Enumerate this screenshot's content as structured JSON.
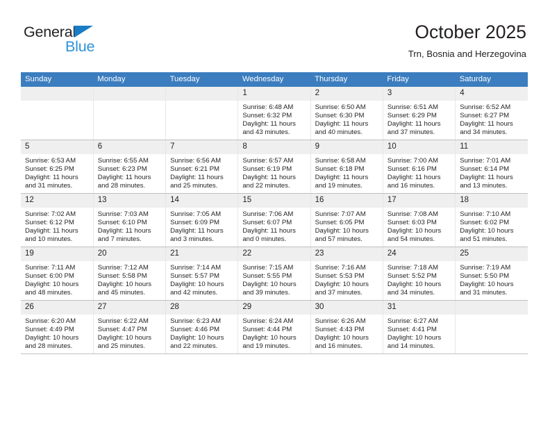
{
  "brand": {
    "name_top": "General",
    "name_bottom": "Blue",
    "accent_color": "#1a7cc4",
    "blue_text_color": "#2f92d8"
  },
  "header": {
    "title": "October 2025",
    "subtitle": "Trn, Bosnia and Herzegovina"
  },
  "calendar": {
    "header_bg": "#3b7dbf",
    "daynum_bg": "#efefef",
    "weekdays": [
      "Sunday",
      "Monday",
      "Tuesday",
      "Wednesday",
      "Thursday",
      "Friday",
      "Saturday"
    ],
    "weeks": [
      [
        {
          "day": "",
          "empty": true,
          "sunrise": "",
          "sunset": "",
          "daylight_1": "",
          "daylight_2": ""
        },
        {
          "day": "",
          "empty": true,
          "sunrise": "",
          "sunset": "",
          "daylight_1": "",
          "daylight_2": ""
        },
        {
          "day": "",
          "empty": true,
          "sunrise": "",
          "sunset": "",
          "daylight_1": "",
          "daylight_2": ""
        },
        {
          "day": "1",
          "empty": false,
          "sunrise": "Sunrise: 6:48 AM",
          "sunset": "Sunset: 6:32 PM",
          "daylight_1": "Daylight: 11 hours",
          "daylight_2": "and 43 minutes."
        },
        {
          "day": "2",
          "empty": false,
          "sunrise": "Sunrise: 6:50 AM",
          "sunset": "Sunset: 6:30 PM",
          "daylight_1": "Daylight: 11 hours",
          "daylight_2": "and 40 minutes."
        },
        {
          "day": "3",
          "empty": false,
          "sunrise": "Sunrise: 6:51 AM",
          "sunset": "Sunset: 6:29 PM",
          "daylight_1": "Daylight: 11 hours",
          "daylight_2": "and 37 minutes."
        },
        {
          "day": "4",
          "empty": false,
          "sunrise": "Sunrise: 6:52 AM",
          "sunset": "Sunset: 6:27 PM",
          "daylight_1": "Daylight: 11 hours",
          "daylight_2": "and 34 minutes."
        }
      ],
      [
        {
          "day": "5",
          "empty": false,
          "sunrise": "Sunrise: 6:53 AM",
          "sunset": "Sunset: 6:25 PM",
          "daylight_1": "Daylight: 11 hours",
          "daylight_2": "and 31 minutes."
        },
        {
          "day": "6",
          "empty": false,
          "sunrise": "Sunrise: 6:55 AM",
          "sunset": "Sunset: 6:23 PM",
          "daylight_1": "Daylight: 11 hours",
          "daylight_2": "and 28 minutes."
        },
        {
          "day": "7",
          "empty": false,
          "sunrise": "Sunrise: 6:56 AM",
          "sunset": "Sunset: 6:21 PM",
          "daylight_1": "Daylight: 11 hours",
          "daylight_2": "and 25 minutes."
        },
        {
          "day": "8",
          "empty": false,
          "sunrise": "Sunrise: 6:57 AM",
          "sunset": "Sunset: 6:19 PM",
          "daylight_1": "Daylight: 11 hours",
          "daylight_2": "and 22 minutes."
        },
        {
          "day": "9",
          "empty": false,
          "sunrise": "Sunrise: 6:58 AM",
          "sunset": "Sunset: 6:18 PM",
          "daylight_1": "Daylight: 11 hours",
          "daylight_2": "and 19 minutes."
        },
        {
          "day": "10",
          "empty": false,
          "sunrise": "Sunrise: 7:00 AM",
          "sunset": "Sunset: 6:16 PM",
          "daylight_1": "Daylight: 11 hours",
          "daylight_2": "and 16 minutes."
        },
        {
          "day": "11",
          "empty": false,
          "sunrise": "Sunrise: 7:01 AM",
          "sunset": "Sunset: 6:14 PM",
          "daylight_1": "Daylight: 11 hours",
          "daylight_2": "and 13 minutes."
        }
      ],
      [
        {
          "day": "12",
          "empty": false,
          "sunrise": "Sunrise: 7:02 AM",
          "sunset": "Sunset: 6:12 PM",
          "daylight_1": "Daylight: 11 hours",
          "daylight_2": "and 10 minutes."
        },
        {
          "day": "13",
          "empty": false,
          "sunrise": "Sunrise: 7:03 AM",
          "sunset": "Sunset: 6:10 PM",
          "daylight_1": "Daylight: 11 hours",
          "daylight_2": "and 7 minutes."
        },
        {
          "day": "14",
          "empty": false,
          "sunrise": "Sunrise: 7:05 AM",
          "sunset": "Sunset: 6:09 PM",
          "daylight_1": "Daylight: 11 hours",
          "daylight_2": "and 3 minutes."
        },
        {
          "day": "15",
          "empty": false,
          "sunrise": "Sunrise: 7:06 AM",
          "sunset": "Sunset: 6:07 PM",
          "daylight_1": "Daylight: 11 hours",
          "daylight_2": "and 0 minutes."
        },
        {
          "day": "16",
          "empty": false,
          "sunrise": "Sunrise: 7:07 AM",
          "sunset": "Sunset: 6:05 PM",
          "daylight_1": "Daylight: 10 hours",
          "daylight_2": "and 57 minutes."
        },
        {
          "day": "17",
          "empty": false,
          "sunrise": "Sunrise: 7:08 AM",
          "sunset": "Sunset: 6:03 PM",
          "daylight_1": "Daylight: 10 hours",
          "daylight_2": "and 54 minutes."
        },
        {
          "day": "18",
          "empty": false,
          "sunrise": "Sunrise: 7:10 AM",
          "sunset": "Sunset: 6:02 PM",
          "daylight_1": "Daylight: 10 hours",
          "daylight_2": "and 51 minutes."
        }
      ],
      [
        {
          "day": "19",
          "empty": false,
          "sunrise": "Sunrise: 7:11 AM",
          "sunset": "Sunset: 6:00 PM",
          "daylight_1": "Daylight: 10 hours",
          "daylight_2": "and 48 minutes."
        },
        {
          "day": "20",
          "empty": false,
          "sunrise": "Sunrise: 7:12 AM",
          "sunset": "Sunset: 5:58 PM",
          "daylight_1": "Daylight: 10 hours",
          "daylight_2": "and 45 minutes."
        },
        {
          "day": "21",
          "empty": false,
          "sunrise": "Sunrise: 7:14 AM",
          "sunset": "Sunset: 5:57 PM",
          "daylight_1": "Daylight: 10 hours",
          "daylight_2": "and 42 minutes."
        },
        {
          "day": "22",
          "empty": false,
          "sunrise": "Sunrise: 7:15 AM",
          "sunset": "Sunset: 5:55 PM",
          "daylight_1": "Daylight: 10 hours",
          "daylight_2": "and 39 minutes."
        },
        {
          "day": "23",
          "empty": false,
          "sunrise": "Sunrise: 7:16 AM",
          "sunset": "Sunset: 5:53 PM",
          "daylight_1": "Daylight: 10 hours",
          "daylight_2": "and 37 minutes."
        },
        {
          "day": "24",
          "empty": false,
          "sunrise": "Sunrise: 7:18 AM",
          "sunset": "Sunset: 5:52 PM",
          "daylight_1": "Daylight: 10 hours",
          "daylight_2": "and 34 minutes."
        },
        {
          "day": "25",
          "empty": false,
          "sunrise": "Sunrise: 7:19 AM",
          "sunset": "Sunset: 5:50 PM",
          "daylight_1": "Daylight: 10 hours",
          "daylight_2": "and 31 minutes."
        }
      ],
      [
        {
          "day": "26",
          "empty": false,
          "sunrise": "Sunrise: 6:20 AM",
          "sunset": "Sunset: 4:49 PM",
          "daylight_1": "Daylight: 10 hours",
          "daylight_2": "and 28 minutes."
        },
        {
          "day": "27",
          "empty": false,
          "sunrise": "Sunrise: 6:22 AM",
          "sunset": "Sunset: 4:47 PM",
          "daylight_1": "Daylight: 10 hours",
          "daylight_2": "and 25 minutes."
        },
        {
          "day": "28",
          "empty": false,
          "sunrise": "Sunrise: 6:23 AM",
          "sunset": "Sunset: 4:46 PM",
          "daylight_1": "Daylight: 10 hours",
          "daylight_2": "and 22 minutes."
        },
        {
          "day": "29",
          "empty": false,
          "sunrise": "Sunrise: 6:24 AM",
          "sunset": "Sunset: 4:44 PM",
          "daylight_1": "Daylight: 10 hours",
          "daylight_2": "and 19 minutes."
        },
        {
          "day": "30",
          "empty": false,
          "sunrise": "Sunrise: 6:26 AM",
          "sunset": "Sunset: 4:43 PM",
          "daylight_1": "Daylight: 10 hours",
          "daylight_2": "and 16 minutes."
        },
        {
          "day": "31",
          "empty": false,
          "sunrise": "Sunrise: 6:27 AM",
          "sunset": "Sunset: 4:41 PM",
          "daylight_1": "Daylight: 10 hours",
          "daylight_2": "and 14 minutes."
        },
        {
          "day": "",
          "empty": true,
          "sunrise": "",
          "sunset": "",
          "daylight_1": "",
          "daylight_2": ""
        }
      ]
    ]
  }
}
